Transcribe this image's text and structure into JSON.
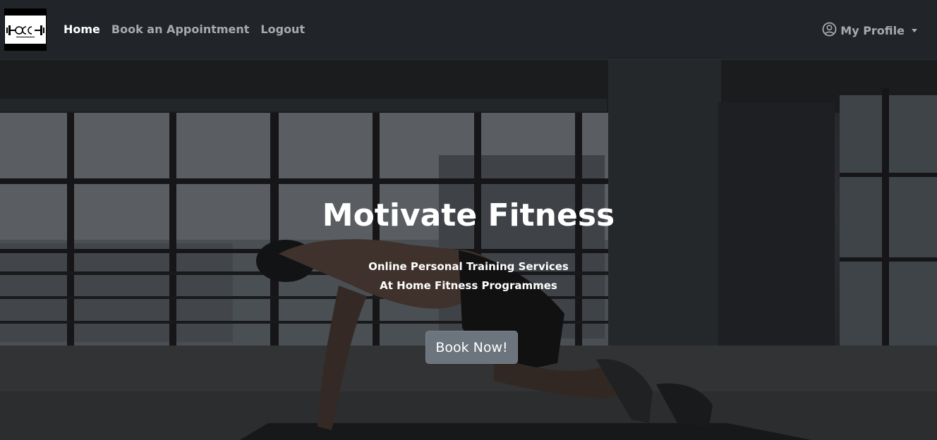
{
  "brand": {
    "logo_text": "OCC",
    "logo_subtext": "OLLY CAREY COACHING"
  },
  "nav": {
    "links": [
      {
        "label": "Home",
        "active": true
      },
      {
        "label": "Book an Appointment",
        "active": false
      },
      {
        "label": "Logout",
        "active": false
      }
    ],
    "profile_label": "My Profile",
    "profile_icon": "user-circle-icon"
  },
  "hero": {
    "title": "Motivate Fitness",
    "subtitle_line1": "Online Personal Training Services",
    "subtitle_line2": "At Home Fitness Programmes",
    "cta_label": "Book Now!"
  },
  "colors": {
    "navbar_bg": "#212529",
    "button_bg": "#6c757d",
    "text_muted": "#a7aaad"
  }
}
